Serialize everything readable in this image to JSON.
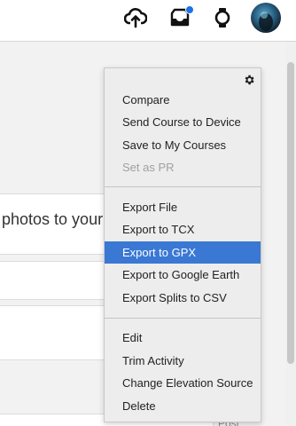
{
  "header": {
    "icons": [
      "cloud-upload-icon",
      "inbox-icon",
      "watch-icon"
    ],
    "notification_color": "#1a73e8"
  },
  "main": {
    "photos_text": "photos to your",
    "post_text": "Post"
  },
  "menu": {
    "gear_icon": "gear-icon",
    "groups": [
      [
        "Compare",
        "Send Course to Device",
        "Save to My Courses",
        "Set as PR"
      ],
      [
        "Export File",
        "Export to TCX",
        "Export to GPX",
        "Export to Google Earth",
        "Export Splits to CSV"
      ],
      [
        "Edit",
        "Trim Activity",
        "Change Elevation Source",
        "Delete"
      ]
    ],
    "disabled_item": "Set as PR",
    "selected_item": "Export to GPX",
    "highlight_color": "#3a78d4"
  }
}
